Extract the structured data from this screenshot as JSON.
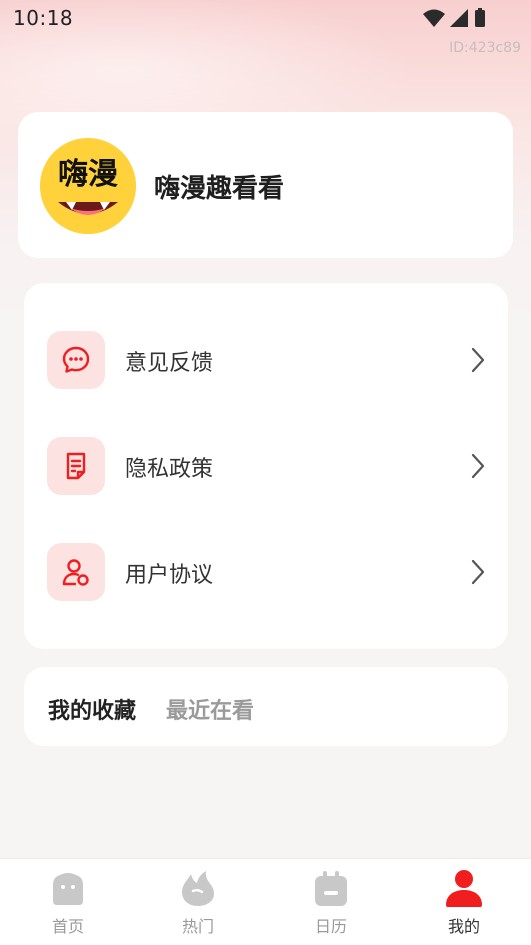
{
  "status_bar": {
    "time": "10:18"
  },
  "user_id": "ID:423c89",
  "profile": {
    "app_name": "嗨漫趣看看",
    "avatar_text": "嗨漫"
  },
  "menu": {
    "items": [
      {
        "label": "意见反馈",
        "icon": "feedback-chat-icon"
      },
      {
        "label": "隐私政策",
        "icon": "privacy-document-icon"
      },
      {
        "label": "用户协议",
        "icon": "user-agreement-icon"
      }
    ]
  },
  "favorites": {
    "tabs": [
      "我的收藏",
      "最近在看"
    ],
    "active_tab": "我的收藏"
  },
  "tabbar": {
    "items": [
      {
        "label": "首页",
        "icon": "home-icon"
      },
      {
        "label": "热门",
        "icon": "fire-icon"
      },
      {
        "label": "日历",
        "icon": "calendar-icon"
      },
      {
        "label": "我的",
        "icon": "profile-icon"
      }
    ],
    "active": "我的"
  },
  "colors": {
    "accent": "#f01e1e",
    "icon_bg": "#fde2e2",
    "inactive": "#c8c8c8"
  }
}
